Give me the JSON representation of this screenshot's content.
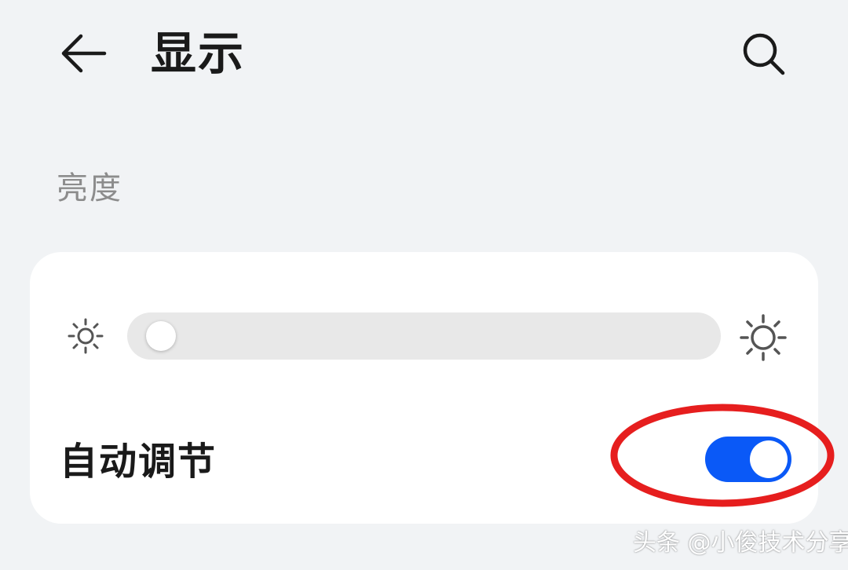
{
  "header": {
    "title": "显示",
    "back_icon": "arrow-left-icon",
    "search_icon": "search-icon"
  },
  "brightness": {
    "section_label": "亮度",
    "slider_level": 0.02,
    "min_icon": "sun-small-icon",
    "max_icon": "sun-large-icon",
    "auto_adjust_label": "自动调节",
    "auto_adjust_enabled": true
  },
  "annotation": {
    "shape": "ellipse",
    "color": "#e61e1e"
  },
  "colors": {
    "background": "#f1f3f5",
    "card": "#ffffff",
    "accent": "#0a59f7",
    "section_label": "#8c8c8c"
  },
  "watermark": "头条 @小俊技术分享"
}
